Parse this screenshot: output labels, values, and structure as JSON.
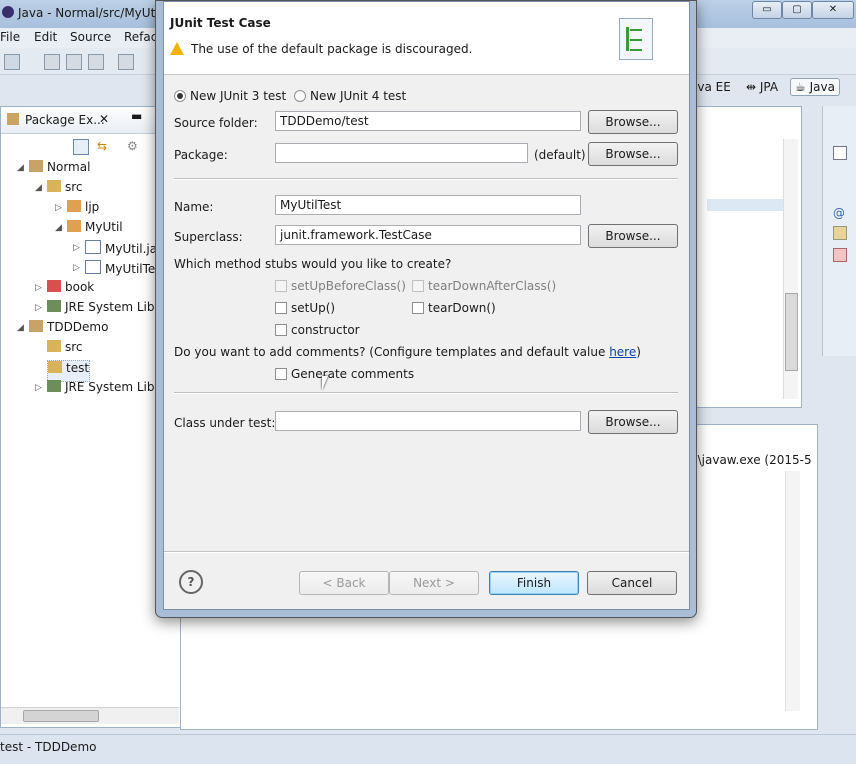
{
  "window": {
    "title": "Java - Normal/src/MyUti",
    "minimize": "▭",
    "maximize": "▢",
    "close": "✕"
  },
  "menu": [
    "File",
    "Edit",
    "Source",
    "Refac"
  ],
  "perspectives": [
    "ava EE",
    "JPA",
    "Java"
  ],
  "package_explorer": {
    "tab_label": "Package Ex...",
    "tree": [
      {
        "label": "Normal",
        "icon": "project-icon",
        "expanded": true
      },
      {
        "label": "src",
        "icon": "source-folder-icon",
        "expanded": true
      },
      {
        "label": "ljp",
        "icon": "package-icon",
        "expanded": false
      },
      {
        "label": "MyUtil",
        "icon": "package-icon",
        "expanded": true
      },
      {
        "label": "MyUtil.ja",
        "icon": "java-file-icon",
        "expanded": false
      },
      {
        "label": "MyUtilTe",
        "icon": "java-file-icon",
        "expanded": false
      },
      {
        "label": "book",
        "icon": "package-icon",
        "expanded": false
      },
      {
        "label": "JRE System Lib",
        "icon": "library-icon",
        "expanded": false
      },
      {
        "label": "TDDDemo",
        "icon": "project-icon",
        "expanded": true
      },
      {
        "label": "src",
        "icon": "source-folder-icon"
      },
      {
        "label": "test",
        "icon": "source-folder-icon"
      },
      {
        "label": "JRE System Lib",
        "icon": "library-icon",
        "expanded": false
      }
    ]
  },
  "console_text": "n\\javaw.exe (2015-5",
  "status": "test - TDDDemo",
  "dialog": {
    "title": "JUnit Test Case",
    "message": "The use of the default package is discouraged.",
    "radio_junit3": "New JUnit 3 test",
    "radio_junit4": "New JUnit 4 test",
    "selected_version": "New JUnit 3 test",
    "source_folder_label": "Source folder:",
    "source_folder_value": "TDDDemo/test",
    "package_label": "Package:",
    "package_value": "",
    "package_default": "(default)",
    "name_label": "Name:",
    "name_value": "MyUtilTest",
    "superclass_label": "Superclass:",
    "superclass_value": "junit.framework.TestCase",
    "stubs_question": "Which method stubs would you like to create?",
    "stubs": {
      "setUpBeforeClass": "setUpBeforeClass()",
      "tearDownAfterClass": "tearDownAfterClass()",
      "setUp": "setUp()",
      "tearDown": "tearDown()",
      "constructor": "constructor"
    },
    "comments_question_prefix": "Do you want to add comments? (Configure templates and default value ",
    "comments_link": "here",
    "comments_question_suffix": ")",
    "generate_comments": "Generate comments",
    "class_under_test_label": "Class under test:",
    "class_under_test_value": "",
    "browse": "Browse...",
    "back": "< Back",
    "next": "Next >",
    "finish": "Finish",
    "cancel": "Cancel",
    "help": "?"
  }
}
